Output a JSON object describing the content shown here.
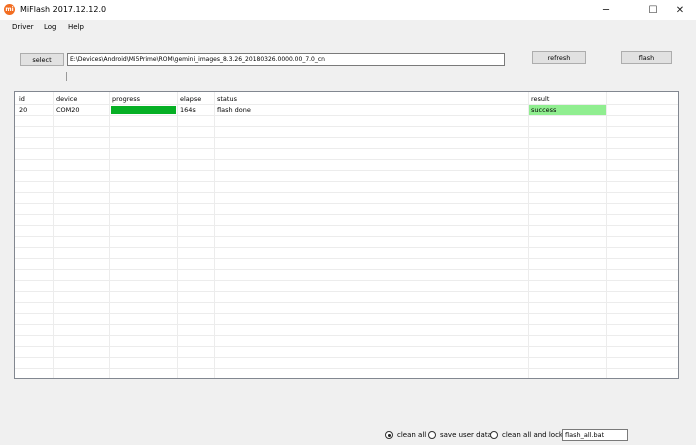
{
  "window": {
    "title": "MiFlash 2017.12.12.0",
    "icon_letter": "mi",
    "accent": "#f26d21"
  },
  "menu": {
    "items": [
      {
        "label": "Driver"
      },
      {
        "label": "Log"
      },
      {
        "label": "Help"
      }
    ]
  },
  "toolbar": {
    "select_label": "select",
    "path_value": "E:\\Devices\\Android\\Mi5Prime\\ROM\\gemini_images_8.3.26_20180326.0000.00_7.0_cn",
    "refresh_label": "refresh",
    "flash_label": "flash"
  },
  "table": {
    "columns": [
      "id",
      "device",
      "progress",
      "elapse",
      "status",
      "result"
    ],
    "rows": [
      {
        "id": "20",
        "device": "COM20",
        "progress": 1.0,
        "elapse": "164s",
        "status": "flash done",
        "result": "success"
      }
    ],
    "progress_color": "#06b025",
    "success_color": "#90ee90"
  },
  "bottom": {
    "options": [
      {
        "label": "clean all",
        "checked": true
      },
      {
        "label": "save user data",
        "checked": false
      },
      {
        "label": "clean all and lock",
        "checked": false
      }
    ],
    "script_value": "flash_all.bat"
  }
}
